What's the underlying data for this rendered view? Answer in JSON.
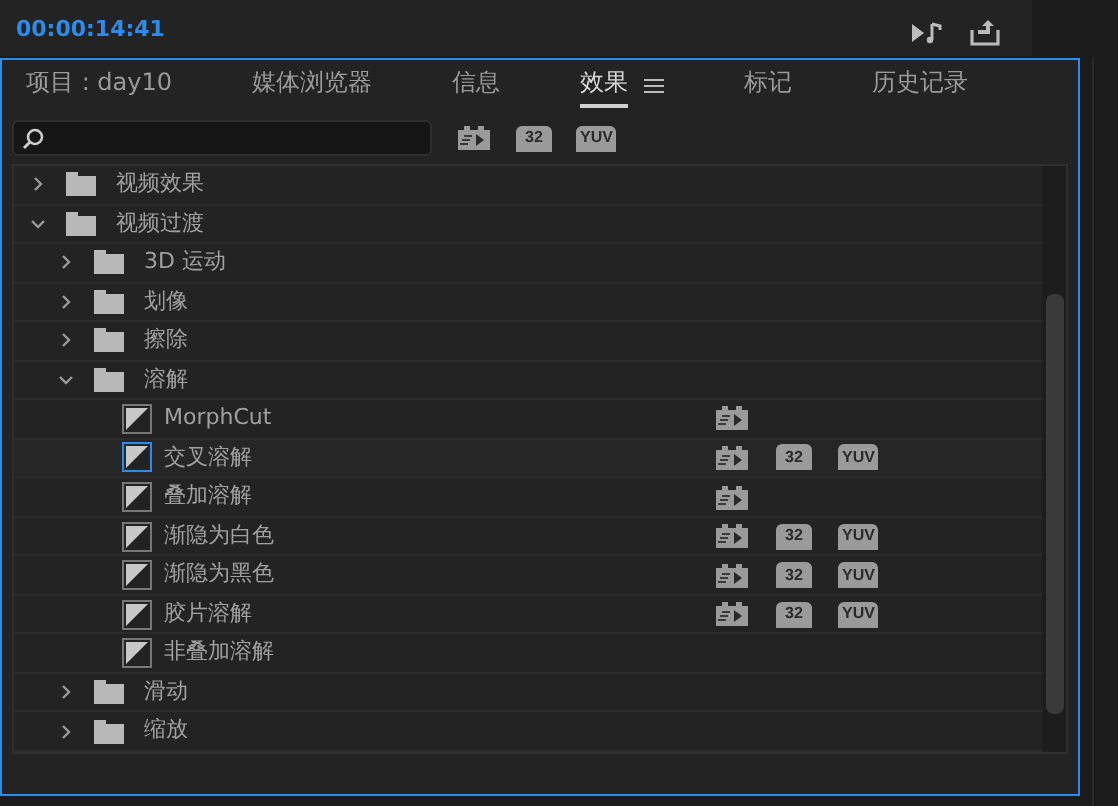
{
  "timecode": "00:00:14:41",
  "tabs": [
    {
      "label": "项目 : day10",
      "selected": false,
      "menu": false
    },
    {
      "label": "媒体浏览器",
      "selected": false,
      "menu": false
    },
    {
      "label": "信息",
      "selected": false,
      "menu": false
    },
    {
      "label": "效果",
      "selected": true,
      "menu": true
    },
    {
      "label": "标记",
      "selected": false,
      "menu": false
    },
    {
      "label": "历史记录",
      "selected": false,
      "menu": false
    }
  ],
  "filter_badges": [
    "32",
    "YUV"
  ],
  "tree": [
    {
      "kind": "folder",
      "name": "视频效果",
      "expanded": false
    },
    {
      "kind": "folder",
      "name": "视频过渡",
      "expanded": true,
      "children": [
        {
          "kind": "folder",
          "name": "3D 运动",
          "expanded": false
        },
        {
          "kind": "folder",
          "name": "划像",
          "expanded": false
        },
        {
          "kind": "folder",
          "name": "擦除",
          "expanded": false
        },
        {
          "kind": "folder",
          "name": "溶解",
          "expanded": true,
          "children": [
            {
              "kind": "effect",
              "name": "MorphCut",
              "selected": false,
              "accelerated": true
            },
            {
              "kind": "effect",
              "name": "交叉溶解",
              "selected": true,
              "accelerated": true,
              "badges": [
                "32",
                "YUV"
              ]
            },
            {
              "kind": "effect",
              "name": "叠加溶解",
              "selected": false,
              "accelerated": true
            },
            {
              "kind": "effect",
              "name": "渐隐为白色",
              "selected": false,
              "accelerated": true,
              "badges": [
                "32",
                "YUV"
              ]
            },
            {
              "kind": "effect",
              "name": "渐隐为黑色",
              "selected": false,
              "accelerated": true,
              "badges": [
                "32",
                "YUV"
              ]
            },
            {
              "kind": "effect",
              "name": "胶片溶解",
              "selected": false,
              "accelerated": true,
              "badges": [
                "32",
                "YUV"
              ]
            },
            {
              "kind": "effect",
              "name": "非叠加溶解",
              "selected": false,
              "accelerated": false
            }
          ]
        },
        {
          "kind": "folder",
          "name": "滑动",
          "expanded": false
        },
        {
          "kind": "folder",
          "name": "缩放",
          "expanded": false
        }
      ]
    }
  ]
}
